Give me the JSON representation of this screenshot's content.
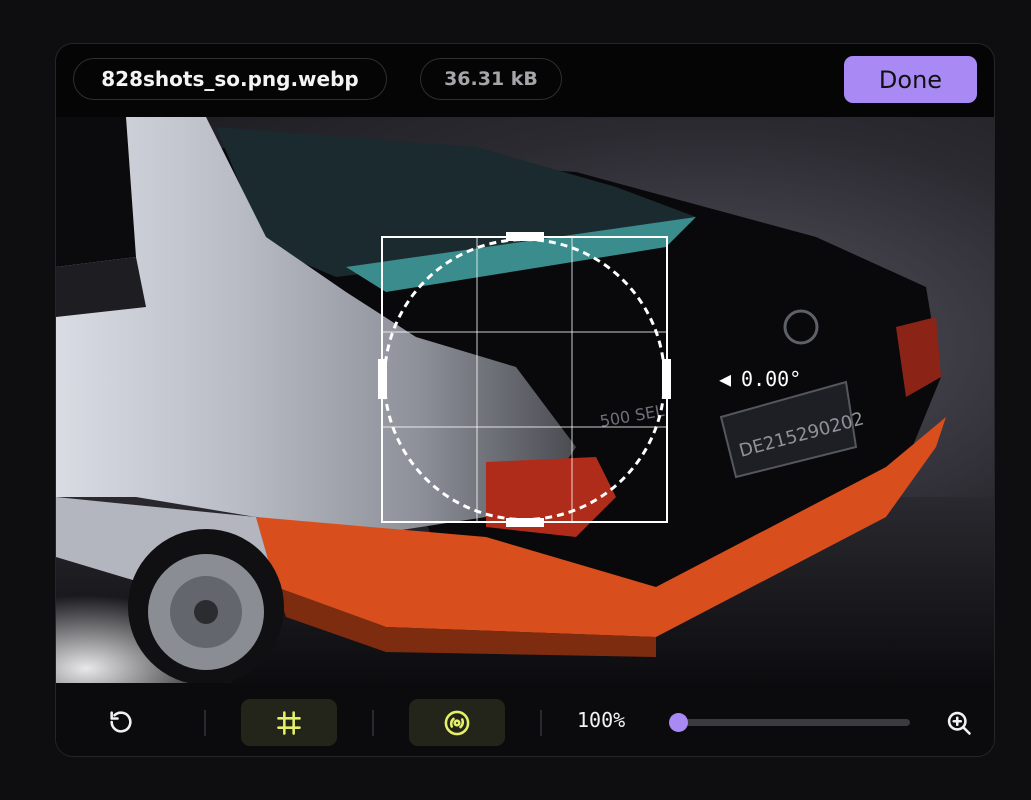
{
  "file": {
    "name": "828shots_so.png.webp",
    "size": "36.31 kB"
  },
  "actions": {
    "done_label": "Done"
  },
  "crop": {
    "rotation_readout": "0.00°",
    "rotation_arrow": "◀",
    "shape": "circle"
  },
  "toolbar": {
    "reset_icon": "rotate-ccw-icon",
    "crop_icon": "crop-grid-icon",
    "mask_icon": "circle-mask-icon",
    "zoom_label": "100%",
    "zoom_fraction": 0.0,
    "zoom_in_icon": "zoom-in-icon"
  },
  "colors": {
    "accent": "#a98af4",
    "active_tool_bg": "#23251a",
    "active_tool_icon": "#e4ef6a"
  }
}
